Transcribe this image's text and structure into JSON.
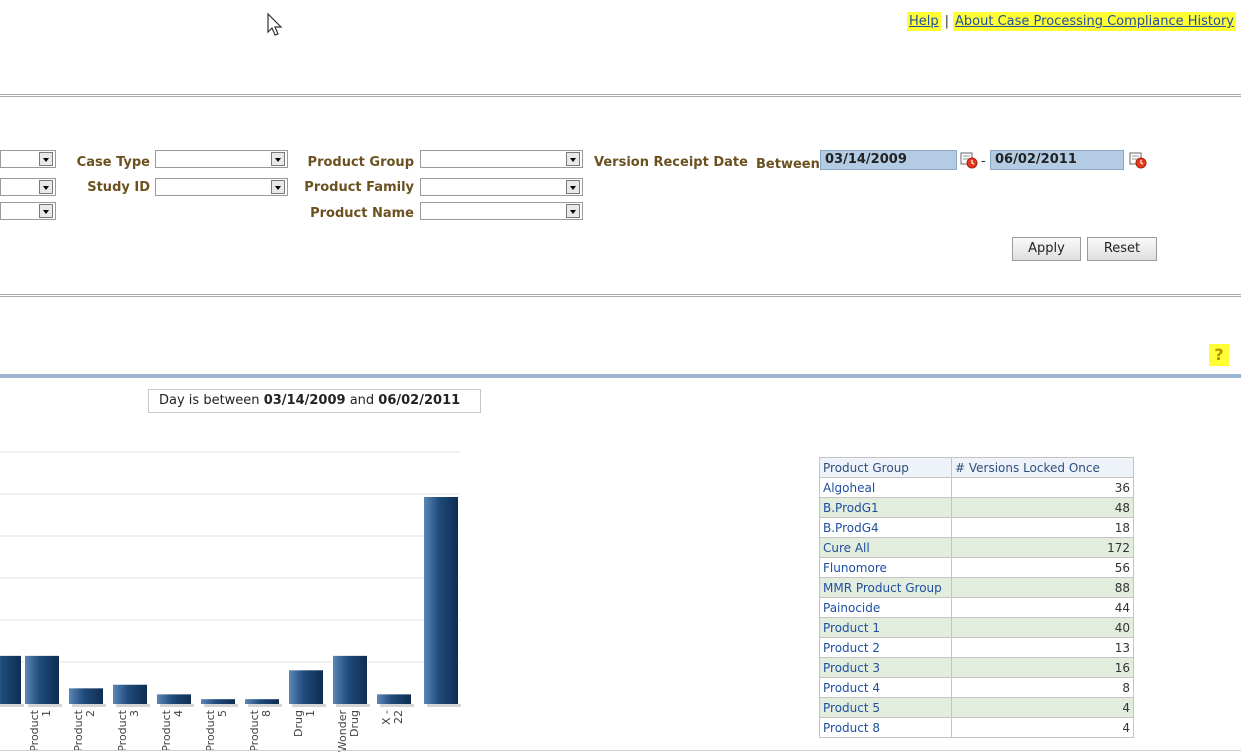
{
  "top_links": {
    "help": "Help",
    "separator": "|",
    "about": "About Case Processing Compliance History"
  },
  "filters": {
    "case_type_label": "Case Type",
    "study_id_label": "Study ID",
    "product_group_label": "Product Group",
    "product_family_label": "Product Family",
    "product_name_label": "Product Name",
    "version_receipt_label": "Version Receipt Date",
    "between_label": "Between",
    "date_from": "03/14/2009",
    "date_dash": "-",
    "date_to": "06/02/2011",
    "apply": "Apply",
    "reset": "Reset"
  },
  "help_badge": "?",
  "filter_summary": {
    "prefix": "Day is between",
    "from": "03/14/2009",
    "and": "and",
    "to": "06/02/2011"
  },
  "chart_data": {
    "type": "bar",
    "categories": [
      "",
      "Product 1",
      "Product 2",
      "Product 3",
      "Product 4",
      "Product 5",
      "Product 8",
      "Drug 1",
      "Wonder Drug",
      "X - 22",
      ""
    ],
    "tick_labels": [
      "",
      "Product 1",
      "Product 2",
      "Product 3",
      "Product 4",
      "Product 5",
      "Product 8",
      "Drug 1",
      "Wonder Drug",
      "X - 22",
      ""
    ],
    "values": [
      40,
      40,
      13,
      16,
      8,
      4,
      4,
      28,
      40,
      8,
      172
    ],
    "color": "#1e4a7a",
    "grid": true
  },
  "table": {
    "headers": [
      "Product Group",
      "# Versions Locked Once"
    ],
    "rows": [
      [
        "Algoheal",
        "36"
      ],
      [
        "B.ProdG1",
        "48"
      ],
      [
        "B.ProdG4",
        "18"
      ],
      [
        "Cure All",
        "172"
      ],
      [
        "Flunomore",
        "56"
      ],
      [
        "MMR Product Group",
        "88"
      ],
      [
        "Painocide",
        "44"
      ],
      [
        "Product 1",
        "40"
      ],
      [
        "Product 2",
        "13"
      ],
      [
        "Product 3",
        "16"
      ],
      [
        "Product 4",
        "8"
      ],
      [
        "Product 5",
        "4"
      ],
      [
        "Product 8",
        "4"
      ]
    ]
  }
}
